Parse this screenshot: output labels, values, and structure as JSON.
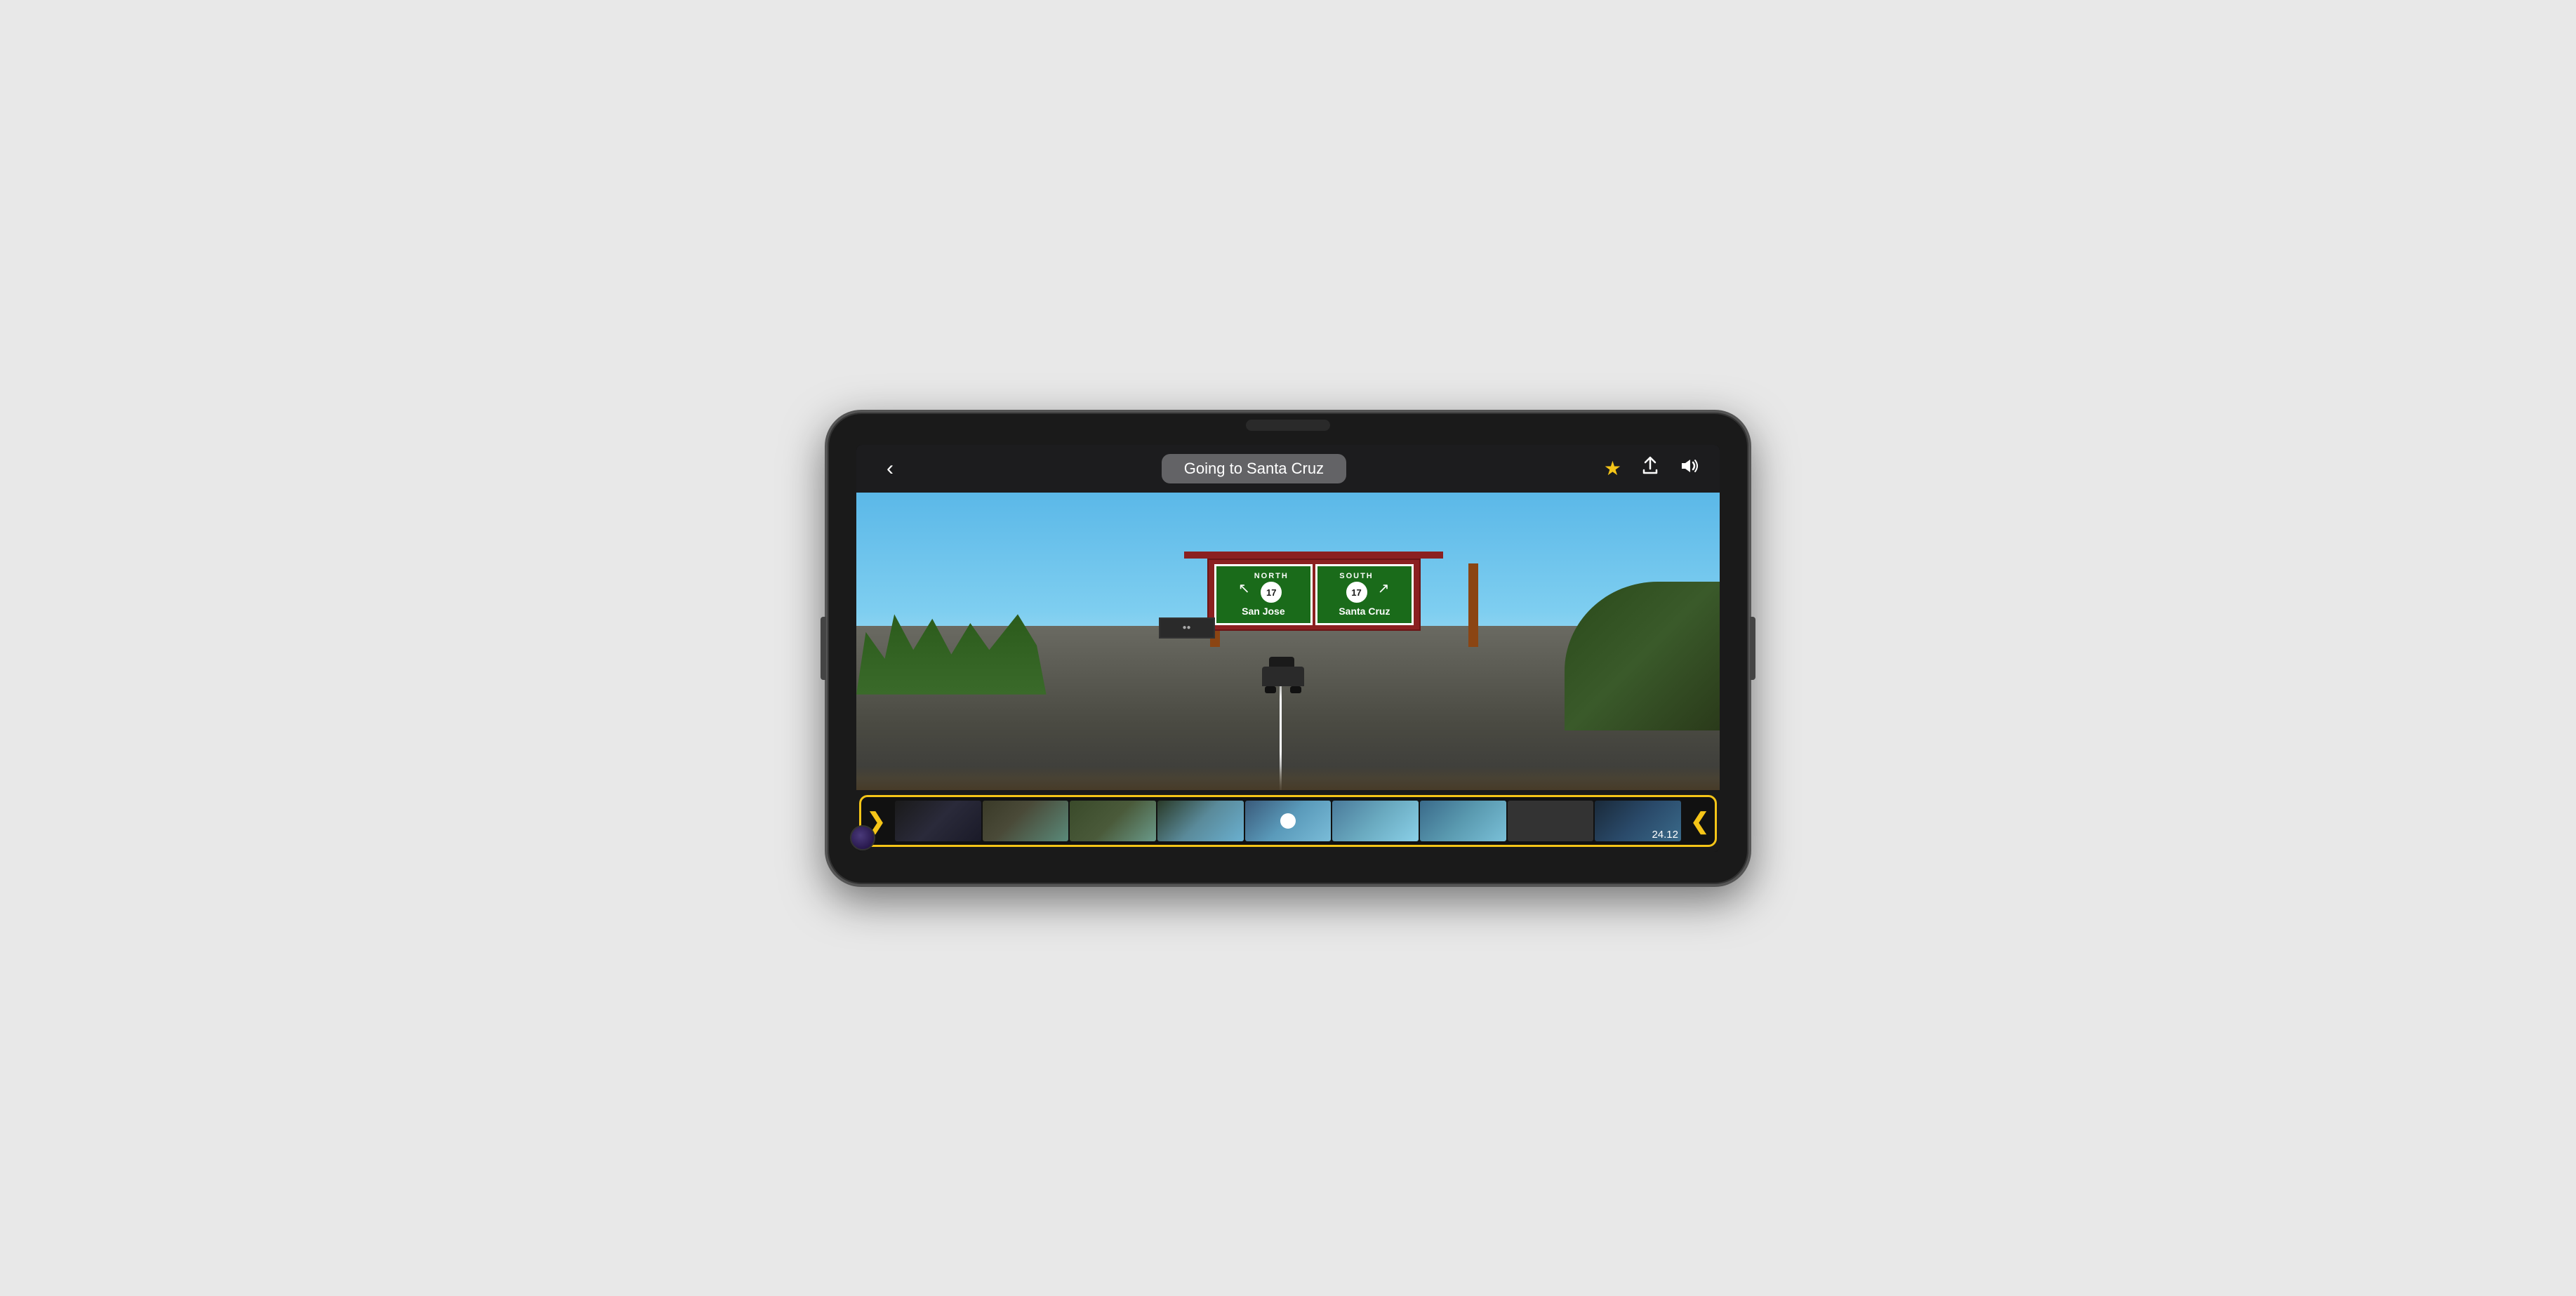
{
  "phone": {
    "title": "Phone device"
  },
  "topBar": {
    "backLabel": "‹",
    "title": "Going to Santa Cruz",
    "starIcon": "★",
    "shareIcon": "⬆",
    "volumeIcon": "🔊"
  },
  "video": {
    "northSign": {
      "direction": "NORTH",
      "routeNumber": "17",
      "city": "San Jose",
      "arrowLeft": "↖"
    },
    "southSign": {
      "direction": "SOUTH",
      "routeNumber": "17",
      "city": "Santa Cruz",
      "arrowRight": "↗"
    }
  },
  "timeline": {
    "arrowLeft": "❯",
    "arrowRight": "❮",
    "timestamp": "24.12",
    "frameCount": 9
  }
}
